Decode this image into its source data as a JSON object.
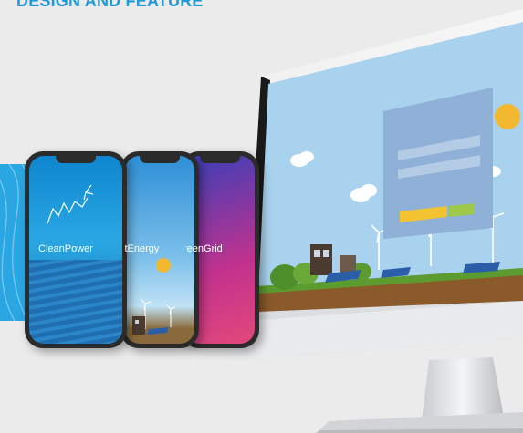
{
  "heading": "DESIGN AND FEATURE",
  "phones": [
    {
      "brand": "CleanPower"
    },
    {
      "brand": "stEnergy"
    },
    {
      "brand": "reenGrid"
    }
  ],
  "colors": {
    "accent": "#2aa7e3",
    "heading": "#1e9ad9",
    "sky": "#a9d2ee",
    "login_panel": "#8fb0d7",
    "button_yellow": "#f2c230",
    "button_green": "#9ec94a"
  },
  "icons": [
    "sun-icon",
    "cloud-icon",
    "wind-turbine-icon",
    "solar-panel-icon",
    "house-icon"
  ]
}
